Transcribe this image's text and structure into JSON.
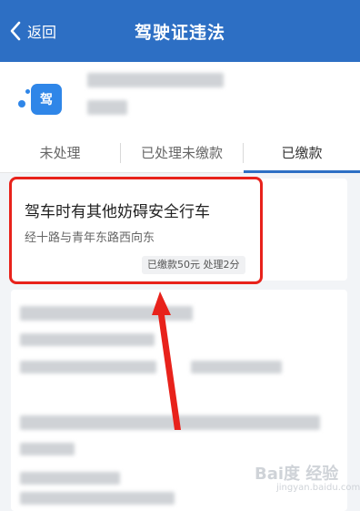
{
  "header": {
    "back_label": "返回",
    "title": "驾驶证违法"
  },
  "profile": {
    "icon_label": "驾"
  },
  "tabs": [
    {
      "label": "未处理",
      "active": false
    },
    {
      "label": "已处理未缴款",
      "active": false
    },
    {
      "label": "已缴款",
      "active": true
    }
  ],
  "violation": {
    "title": "驾车时有其他妨碍安全行车",
    "place": "经十路与青年东路西向东",
    "status": "已缴款50元 处理2分"
  },
  "watermark": {
    "text": "Bai度 经验",
    "sub": "jingyan.baidu.com"
  },
  "colors": {
    "header": "#2d6fc4",
    "highlight": "#e8221b",
    "arrow": "#e8221b"
  }
}
